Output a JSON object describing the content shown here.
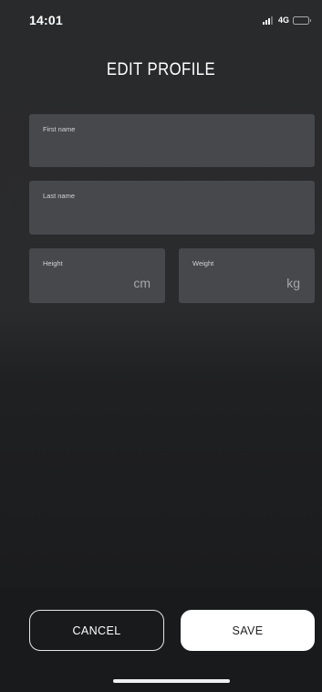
{
  "status_bar": {
    "time": "14:01",
    "network": "4G",
    "icons": [
      "signal-icon",
      "battery-icon"
    ]
  },
  "header": {
    "title": "EDIT PROFILE"
  },
  "form": {
    "first_name": {
      "label": "First name",
      "value": ""
    },
    "last_name": {
      "label": "Last name",
      "value": ""
    },
    "height": {
      "label": "Height",
      "value": "",
      "unit": "cm"
    },
    "weight": {
      "label": "Weight",
      "value": "",
      "unit": "kg"
    }
  },
  "actions": {
    "cancel_label": "CANCEL",
    "save_label": "SAVE"
  },
  "colors": {
    "background": "#1f2022",
    "field_background": "#46484c",
    "save_button": "#ffffff",
    "text": "#ffffff"
  }
}
